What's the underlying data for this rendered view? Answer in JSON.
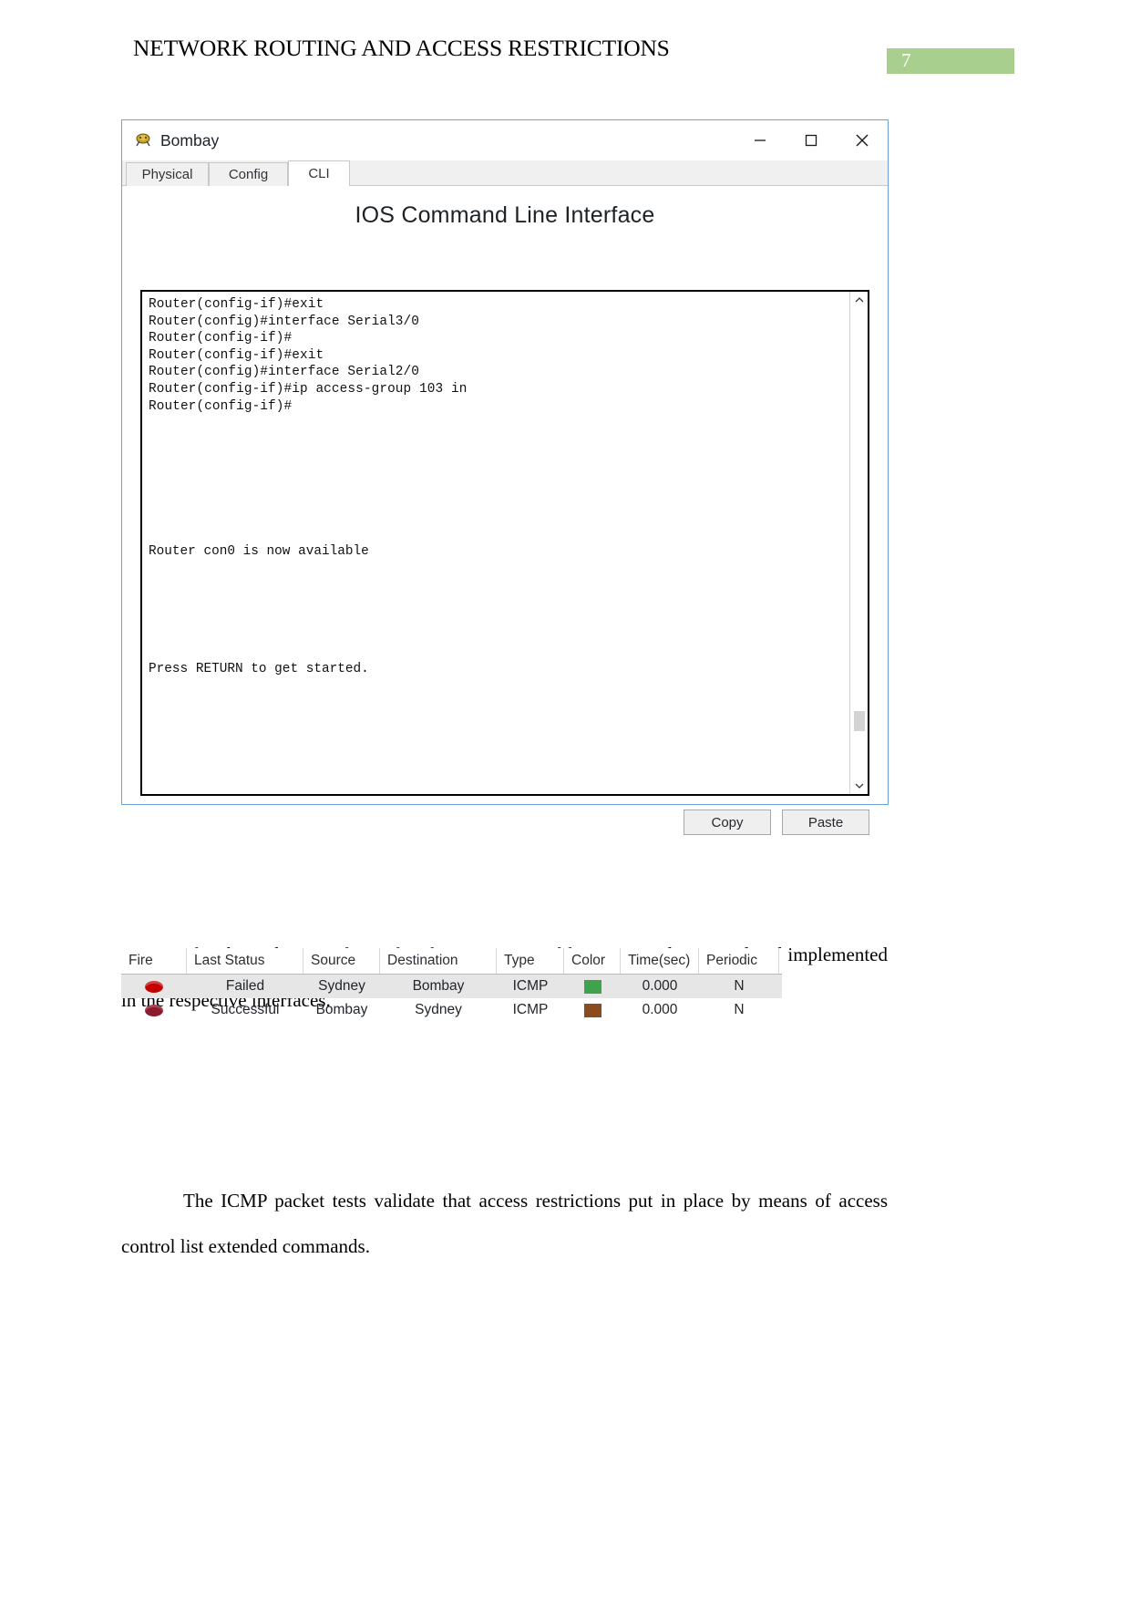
{
  "document": {
    "title": "NETWORK ROUTING AND ACCESS RESTRICTIONS",
    "page_number": "7",
    "page_number_bg": "#a9cf8f",
    "paragraph_1": "The above diagram shows that the access control list commands are used and implemented in the respective interfaces.",
    "paragraph_2": "The ICMP packet tests validate that access restrictions put in place by means of access control list extended commands."
  },
  "packet_tracer_window": {
    "title": "Bombay",
    "window_controls": {
      "minimize": "–",
      "maximize": "□",
      "close": "×"
    },
    "tabs": [
      {
        "label": "Physical",
        "active": false
      },
      {
        "label": "Config",
        "active": false
      },
      {
        "label": "CLI",
        "active": true
      }
    ],
    "heading": "IOS Command Line Interface",
    "terminal": {
      "block_1": "Router(config-if)#exit\nRouter(config)#interface Serial3/0\nRouter(config-if)#\nRouter(config-if)#exit\nRouter(config)#interface Serial2/0\nRouter(config-if)#ip access-group 103 in\nRouter(config-if)#",
      "block_2": "Router con0 is now available",
      "block_3": "Press RETURN to get started."
    },
    "buttons": {
      "copy": "Copy",
      "paste": "Paste"
    },
    "scrollbar": {
      "up_arrow": "∧",
      "down_arrow": "∨"
    }
  },
  "simulation_table": {
    "columns": [
      "Fire",
      "Last Status",
      "Source",
      "Destination",
      "Type",
      "Color",
      "Time(sec)",
      "Periodic"
    ],
    "rows": [
      {
        "fire": "red-dot-icon",
        "last_status": "Failed",
        "source": "Sydney",
        "destination": "Bombay",
        "type": "ICMP",
        "color": "#3fa34d",
        "time_sec": "0.000",
        "periodic": "N"
      },
      {
        "fire": "dark-red-dot-icon",
        "last_status": "Successful",
        "source": "Bombay",
        "destination": "Sydney",
        "type": "ICMP",
        "color": "#8a4b1e",
        "time_sec": "0.000",
        "periodic": "N"
      }
    ]
  }
}
